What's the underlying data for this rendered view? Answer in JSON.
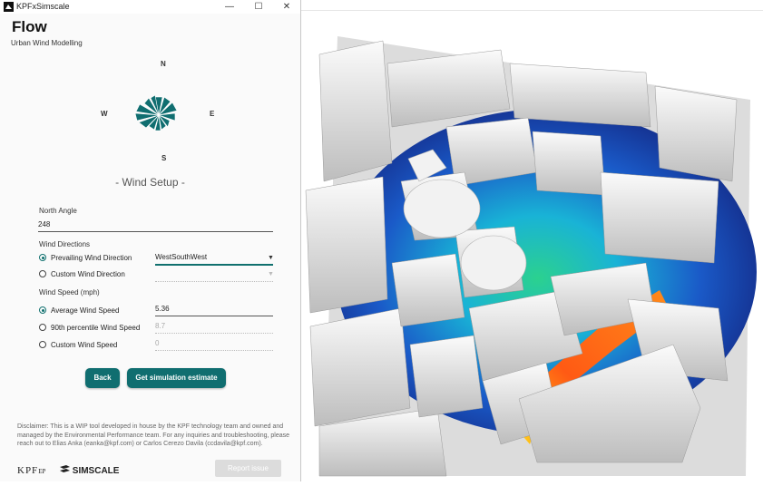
{
  "window": {
    "title": "KPFxSimscale",
    "minimize": "—",
    "maximize": "☐",
    "close": "✕"
  },
  "header": {
    "title": "Flow",
    "subtitle": "Urban Wind Modelling"
  },
  "compass": {
    "north": "N",
    "south": "S",
    "east": "E",
    "west": "W"
  },
  "section_title": "- Wind Setup -",
  "north_angle": {
    "label": "North Angle",
    "value": "248"
  },
  "wind_directions": {
    "label": "Wind Directions",
    "prevailing_label": "Prevailing Wind Direction",
    "prevailing_value": "WestSouthWest",
    "custom_label": "Custom Wind Direction"
  },
  "wind_speed": {
    "label": "Wind Speed (mph)",
    "average_label": "Average Wind Speed",
    "average_value": "5.36",
    "p90_label": "90th percentile Wind Speed",
    "p90_value": "8.7",
    "custom_label": "Custom Wind Speed",
    "custom_value": "0"
  },
  "buttons": {
    "back": "Back",
    "estimate": "Get simulation estimate",
    "report": "Report issue"
  },
  "disclaimer": "Disclaimer: This is a WIP tool developed in house by the KPF technology team and owned and managed by the Environmental Performance team. For any inquiries and troubleshooting, please reach out to Elias Anka (eanka@kpf.com) or Carlos Cerezo Davila (ccdavila@kpf.com).",
  "logos": {
    "kpf": "KPF",
    "kpf_suffix": "EP",
    "simscale": "SIMSCALE"
  },
  "colors": {
    "accent": "#106e70",
    "flow_low": "#1a3aa8",
    "flow_mid": "#22c3c0",
    "flow_high": "#ff4a1a"
  }
}
